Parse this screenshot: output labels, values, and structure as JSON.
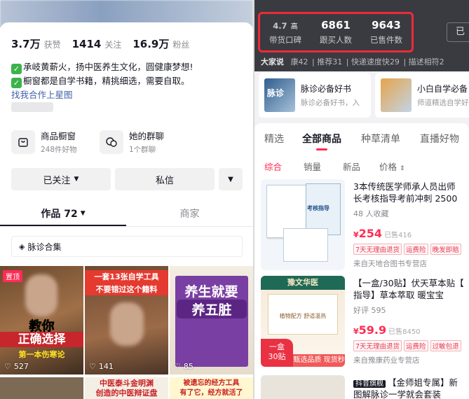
{
  "profile": {
    "stats": [
      {
        "value": "3.7万",
        "label": "获赞"
      },
      {
        "value": "1414",
        "label": "关注"
      },
      {
        "value": "16.9万",
        "label": "粉丝"
      }
    ],
    "bio_lines": [
      "承岐黄薪火，扬中医养生文化，圆健康梦想!",
      "橱窗都是自学书籍，精挑细选，需要自取。"
    ],
    "bio_link": "找我合作上星图",
    "features": [
      {
        "title": "商品橱窗",
        "sub": "248件好物",
        "icon": "shop-window-icon"
      },
      {
        "title": "她的群聊",
        "sub": "1个群聊",
        "icon": "chat-bubbles-icon"
      }
    ],
    "followed_label": "已关注",
    "message_label": "私信",
    "tabs": [
      {
        "label": "作品 72"
      },
      {
        "label": "商家"
      }
    ],
    "collection_label": "脉诊合集",
    "thumbs": [
      {
        "views": "527",
        "pinned": "置顶",
        "line1": "教你",
        "line2": "正确选择",
        "line3": "第一本伤寒论"
      },
      {
        "views": "141",
        "line1": "一套13张自学工具",
        "line2": "不要错过这个籍料"
      },
      {
        "views": "85",
        "line1": "养生就要",
        "line2": "养五脏"
      }
    ],
    "thumbs_row2": [
      {
        "line1": ""
      },
      {
        "line1": "中医泰斗金明渊",
        "line2": "创造的中医辩证盘"
      },
      {
        "line1": "被遗忘的经方工具",
        "line2": "有了它，经方就活了"
      }
    ]
  },
  "shop": {
    "top_stats": [
      {
        "value": "4.7",
        "suffix": "高",
        "label": "带货口碑"
      },
      {
        "value": "6861",
        "label": "跟买人数"
      },
      {
        "value": "9643",
        "label": "已售件数"
      }
    ],
    "top_button": "已",
    "ratings": [
      {
        "label": "大家说",
        "value": ""
      },
      {
        "label": "康",
        "value": "42"
      },
      {
        "label": "推荐",
        "value": "31"
      },
      {
        "label": "快递速度快",
        "value": "29"
      },
      {
        "label": "描述相符",
        "value": "2"
      }
    ],
    "promos": [
      {
        "title": "脉诊必备好书",
        "sub": "脉诊必备好书，入",
        "cover": "脉诊"
      },
      {
        "title": "小白自学必备",
        "sub": "师道精选自学好"
      }
    ],
    "tabs": [
      "精选",
      "全部商品",
      "种草清单",
      "直播好物"
    ],
    "sorts": [
      "综合",
      "销量",
      "新品",
      "价格"
    ],
    "products": [
      {
        "title1": "3本传统医学师承人员出师",
        "title2": "长考核指导考前冲刺 2500",
        "meta": "48 人收藏",
        "price": "254",
        "sold": "已售416",
        "tags": [
          "7天无理由退货",
          "运费险",
          "晚发即赔"
        ],
        "shop": "来自天地合图书专营店",
        "cover_text": "考核指导"
      },
      {
        "title1": "【一盒/30贴】伏天草本贴【",
        "title2": "指导】草本萃取  暖宝宝",
        "meta": "好评 595",
        "price": "59.9",
        "sold": "已售8450",
        "tags": [
          "7天无理由退货",
          "运费险",
          "过敏包退"
        ],
        "shop": "来自豫康药业专营店",
        "brand": "豫文华医",
        "badge_top": "一盒",
        "badge_bottom": "30贴",
        "strip": "甄选品质  现货秒发",
        "cover_text": "植物配方 舒适温热"
      },
      {
        "badge": "抖音旗舰",
        "title1": "【金师姐专属】新",
        "title2": "图解脉诊一学就会套装"
      }
    ]
  },
  "colors": {
    "accent": "#fe2c55",
    "highlight_box": "#ec2b3a",
    "check": "#3bb34a"
  }
}
